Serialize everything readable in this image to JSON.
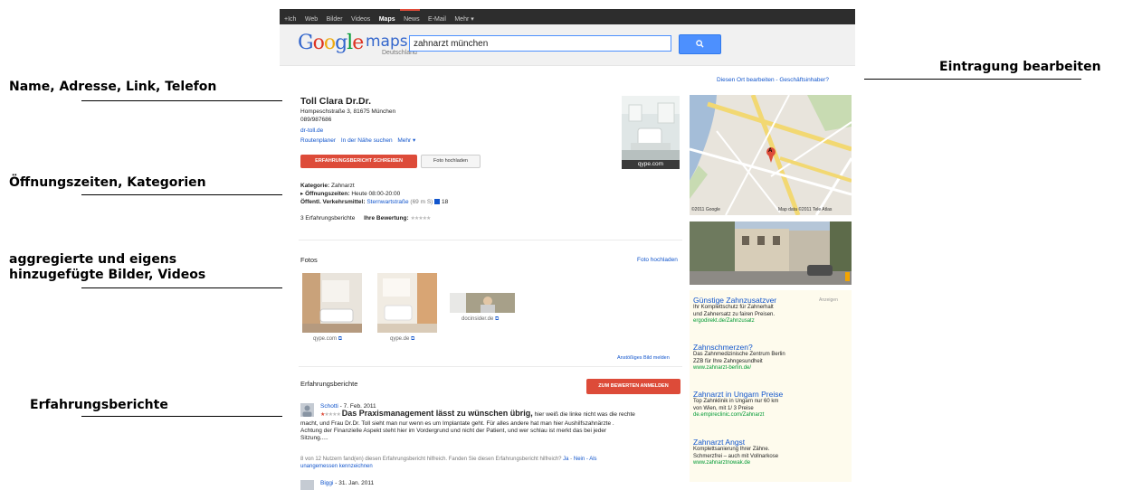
{
  "annotations": {
    "name_addr": "Name, Adresse, Link, Telefon",
    "edit_entry": "Eintragung bearbeiten",
    "hours": "Öffnungszeiten, Kategorien",
    "images_line1": "aggregierte und eigens",
    "images_line2": "hinzugefügte Bilder, Videos",
    "reviews": "Erfahrungsberichte"
  },
  "topbar": {
    "items": [
      "+Ich",
      "Web",
      "Bilder",
      "Videos",
      "Maps",
      "News",
      "E-Mail",
      "Mehr ▾"
    ],
    "active": "Maps"
  },
  "header": {
    "logo": "Google",
    "maps": "maps",
    "country": "Deutschland",
    "query": "zahnarzt münchen",
    "search_icon": "search-icon"
  },
  "listing": {
    "edit_link": "Diesen Ort bearbeiten - Geschäftsinhaber?",
    "name": "Toll Clara Dr.Dr.",
    "address": "Hompeschstraße 3, 81675 München",
    "phone": "089/987686",
    "website": "dr-toll.de",
    "links": {
      "route": "Routenplaner",
      "nearby": "In der Nähe suchen",
      "more": "Mehr ▾"
    },
    "btn_review": "ERFAHRUNGSBERICHT SCHREIBEN",
    "btn_photo": "Foto hochladen",
    "photo_caption": "qype.com",
    "category_label": "Kategorie:",
    "category": "Zahnarzt",
    "hours_label": "Öffnungszeiten:",
    "hours": "Heute 08:00-20:00",
    "transit_label": "Öffentl. Verkehrsmittel:",
    "transit_stop": "Sternwartstraße",
    "transit_dist": "(69 m S)",
    "transit_line": "18",
    "reviews_count": "3 Erfahrungsberichte",
    "your_rating": "Ihre Bewertung:"
  },
  "photos": {
    "title": "Fotos",
    "upload": "Foto hochladen",
    "items": [
      {
        "caption": "qype.com"
      },
      {
        "caption": "qype.de"
      },
      {
        "caption": "docinsider.de"
      }
    ],
    "report": "Anstößiges Bild melden"
  },
  "reviews": {
    "title": "Erfahrungsberichte",
    "login_btn": "ZUM BEWERTEN ANMELDEN",
    "items": [
      {
        "author": "Schotti",
        "date": " - 7. Feb. 2011",
        "headline": "Das Praxismanagement lässt zu wünschen übrig,",
        "text1": "hier weiß die linke nicht was die rechte",
        "text2": "macht, und Frau Dr.Dr. Toll sieht man nur wenn es um Implantate geht. Für alles andere hat man hier Aushilfszahnärzte .",
        "text3": "Achtung der Finanzielle Aspekt steht hier im Vordergrund und nicht der Patient, und wer schlau ist merkt das bei jeder",
        "text4": "Sitzung.....",
        "helpful": "8 von 12 Nutzern fand(en) diesen Erfahrungsbericht hilfreich. Fanden Sie diesen Erfahrungsbericht hilfreich?",
        "yes": "Ja",
        "no": "Nein",
        "flag1": "- Als",
        "flag2": "unangemessen kennzeichnen"
      },
      {
        "author": "Biggi",
        "date": " - 31. Jan. 2011"
      }
    ]
  },
  "map": {
    "copyright_left": "©2011 Google",
    "copyright_right": "Map data ©2011 Tele Atlas",
    "marker": "A"
  },
  "ads": {
    "label": "Anzeigen",
    "items": [
      {
        "title": "Günstige Zahnzusatzver",
        "l1": "Ihr Komplettschutz für Zahnerhalt",
        "l2": "und Zahnersatz zu fairen Preisen.",
        "url": "ergodirekt.de/Zahnzusatz"
      },
      {
        "title": "Zahnschmerzen?",
        "l1": "Das Zahnmedizinische Zentrum Berlin",
        "l2": "ZZB für Ihre Zahngesundheit",
        "url": "www.zahnarzt-berlin.de/"
      },
      {
        "title": "Zahnarzt in Ungarn Preise",
        "l1": "Top Zahnklinik in Ungarn nur 60 km",
        "l2": "von Wien, mit 1/ 3 Preise",
        "url": "de.empireclinic.com/Zahnarzt"
      },
      {
        "title": "Zahnarzt Angst",
        "l1": "Komplettsanierung Ihrer Zähne.",
        "l2": "Schmerzfrei – auch mit Vollnarkose",
        "url": "www.zahnarztnowak.de"
      }
    ]
  },
  "colors": {
    "accent_red": "#dd4b39",
    "link_blue": "#1155cc",
    "ad_green": "#009933",
    "topbar": "#2d2d2d"
  }
}
